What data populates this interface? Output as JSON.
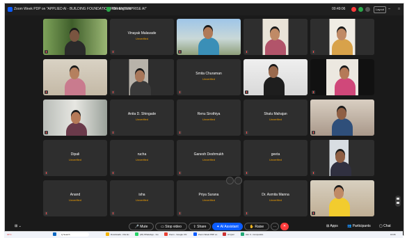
{
  "window": {
    "title": "Zoom Week PDP on \"APPLIED AI - BUILDING FOUNDATION FOR ENTERPRISE AI\"",
    "meeting_info": "Meeting info",
    "timer": "00:49:06",
    "layout_label": "Layout"
  },
  "participants": [
    {
      "name": "",
      "status": "",
      "video": true
    },
    {
      "name": "Vinayak Malavade",
      "status": "Unverified",
      "video": false
    },
    {
      "name": "",
      "status": "",
      "video": true
    },
    {
      "name": "",
      "status": "",
      "video": true
    },
    {
      "name": "",
      "status": "",
      "video": true
    },
    {
      "name": "",
      "status": "",
      "video": true
    },
    {
      "name": "",
      "status": "",
      "video": true
    },
    {
      "name": "Smita Churaman",
      "status": "Unverified",
      "video": false
    },
    {
      "name": "",
      "status": "",
      "video": true
    },
    {
      "name": "",
      "status": "",
      "video": true
    },
    {
      "name": "",
      "status": "",
      "video": true
    },
    {
      "name": "Anita D. Shingade",
      "status": "Unverified",
      "video": false
    },
    {
      "name": "Renu Sirothiya",
      "status": "Unverified",
      "video": false
    },
    {
      "name": "Shalu Mahajan",
      "status": "Unverified",
      "video": false
    },
    {
      "name": "",
      "status": "",
      "video": true
    },
    {
      "name": "Dipali",
      "status": "Unverified",
      "video": false
    },
    {
      "name": "rucha",
      "status": "Unverified",
      "video": false
    },
    {
      "name": "Ganesh Deshmukh",
      "status": "Unverified",
      "video": false
    },
    {
      "name": "geeta",
      "status": "Unverified",
      "video": false
    },
    {
      "name": "",
      "status": "",
      "video": true
    },
    {
      "name": "Anand",
      "status": "Unverified",
      "video": false
    },
    {
      "name": "isha",
      "status": "Unverified",
      "video": false
    },
    {
      "name": "Priya Surana",
      "status": "Unverified",
      "video": false
    },
    {
      "name": "Dr. Asmita Manna",
      "status": "Unverified",
      "video": false
    },
    {
      "name": "",
      "status": "",
      "video": true
    }
  ],
  "toolbar": {
    "mute": "Mute",
    "stop_video": "Stop video",
    "share": "Share",
    "ai_assistant": "AI Assistant",
    "raise": "Raise",
    "apps": "Apps",
    "participants": "Participants",
    "chat": "Chat"
  },
  "taskbar": {
    "weather": "30°C",
    "search": "Q Search",
    "items": [
      "Downloads - File Ex",
      "(20) WhatsApp - Go",
      "Zoom - Google Chr",
      "Zoom Week PDP on",
      "AI Quiz",
      "Aim 3 - Compositio"
    ],
    "time": "16:06"
  },
  "colors": {
    "unverified": "#f2a000",
    "accent": "#0b5cff",
    "tile": "#2e2e2e"
  }
}
